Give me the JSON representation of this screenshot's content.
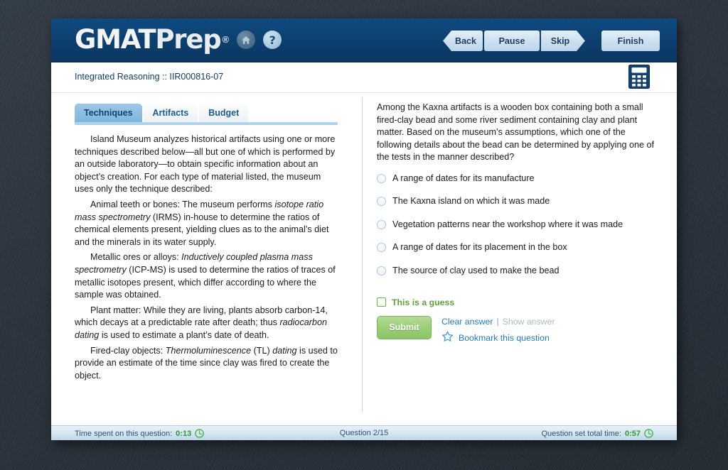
{
  "brand": {
    "logo_gmat": "GMAT",
    "logo_prep": "Prep",
    "registered_mark": "®",
    "home_icon": "home-icon",
    "help_icon": "question-mark-icon",
    "help_label": "?"
  },
  "nav": {
    "back_label": "Back",
    "pause_label": "Pause",
    "skip_label": "Skip",
    "finish_label": "Finish"
  },
  "sub_header": {
    "breadcrumb": "Integrated Reasoning :: IIR000816-07",
    "calculator_icon": "calculator-icon"
  },
  "left_panel": {
    "tabs": [
      {
        "label": "Techniques",
        "active": true
      },
      {
        "label": "Artifacts",
        "active": false
      },
      {
        "label": "Budget",
        "active": false
      }
    ],
    "passage": [
      {
        "runs": [
          {
            "text": "Island Museum analyzes historical artifacts using one or more techniques described below—all but one of which is performed by an outside laboratory—to obtain specific information about an object’s creation. For each type of material listed, the museum uses only the technique described:",
            "italic": false
          }
        ]
      },
      {
        "runs": [
          {
            "text": "Animal teeth or bones: The museum performs ",
            "italic": false
          },
          {
            "text": "isotope ratio mass spectrometry",
            "italic": true
          },
          {
            "text": " (IRMS) in-house to determine the ratios of chemical elements present, yielding clues as to the animal’s diet and the minerals in its water supply.",
            "italic": false
          }
        ]
      },
      {
        "runs": [
          {
            "text": "Metallic ores or alloys: ",
            "italic": false
          },
          {
            "text": "Inductively coupled plasma mass spectrometry",
            "italic": true
          },
          {
            "text": " (ICP-MS) is used to determine the ratios of traces of metallic isotopes present, which differ according to where the sample was obtained.",
            "italic": false
          }
        ]
      },
      {
        "runs": [
          {
            "text": "Plant matter: While they are living, plants absorb carbon-14, which decays at a predictable rate after death; thus ",
            "italic": false
          },
          {
            "text": "radiocarbon dating",
            "italic": true
          },
          {
            "text": " is used to estimate a plant’s date of death.",
            "italic": false
          }
        ]
      },
      {
        "runs": [
          {
            "text": "Fired-clay objects: ",
            "italic": false
          },
          {
            "text": "Thermoluminescence",
            "italic": true
          },
          {
            "text": " (TL) ",
            "italic": false
          },
          {
            "text": "dating",
            "italic": true
          },
          {
            "text": " is used to provide an estimate of the time since clay was fired to create the object.",
            "italic": false
          }
        ]
      }
    ]
  },
  "right_panel": {
    "question_stem": "Among the Kaxna artifacts is a wooden box containing both a small fired-clay bead and some river sediment containing clay and plant matter. Based on the museum’s assumptions, which one of the following details about the bead can be determined by applying one of the tests in the manner described?",
    "options": [
      {
        "label": "A range of dates for its manufacture",
        "selected": false
      },
      {
        "label": "The Kaxna island on which it was made",
        "selected": false
      },
      {
        "label": "Vegetation patterns near the workshop where it was made",
        "selected": false
      },
      {
        "label": "A range of dates for its placement in the box",
        "selected": false
      },
      {
        "label": "The source of clay used to make the bead",
        "selected": false
      }
    ],
    "guess": {
      "label": "This is a guess",
      "checked": false
    },
    "submit_label": "Submit",
    "clear_answer_label": "Clear answer",
    "link_separator": "|",
    "show_answer_label": "Show answer",
    "bookmark_label": "Bookmark this question",
    "bookmark_icon": "star-outline-icon"
  },
  "footer": {
    "time_spent_label": "Time spent on this question:",
    "time_spent_value": "0:13",
    "question_counter": "Question 2/15",
    "total_time_label": "Question set total time:",
    "total_time_value": "0:57",
    "clock_icon": "clock-icon"
  },
  "colors": {
    "brand_navy": "#0d3f6e",
    "accent_blue": "#2a7ab8",
    "active_tab_blue": "#7fb6dd",
    "green_accent": "#5e9f3e",
    "submit_green": "#9bce77",
    "timer_green": "#2e9b2e",
    "desktop_slate": "#2b343d",
    "disabled_gray": "#a9bcc9"
  }
}
